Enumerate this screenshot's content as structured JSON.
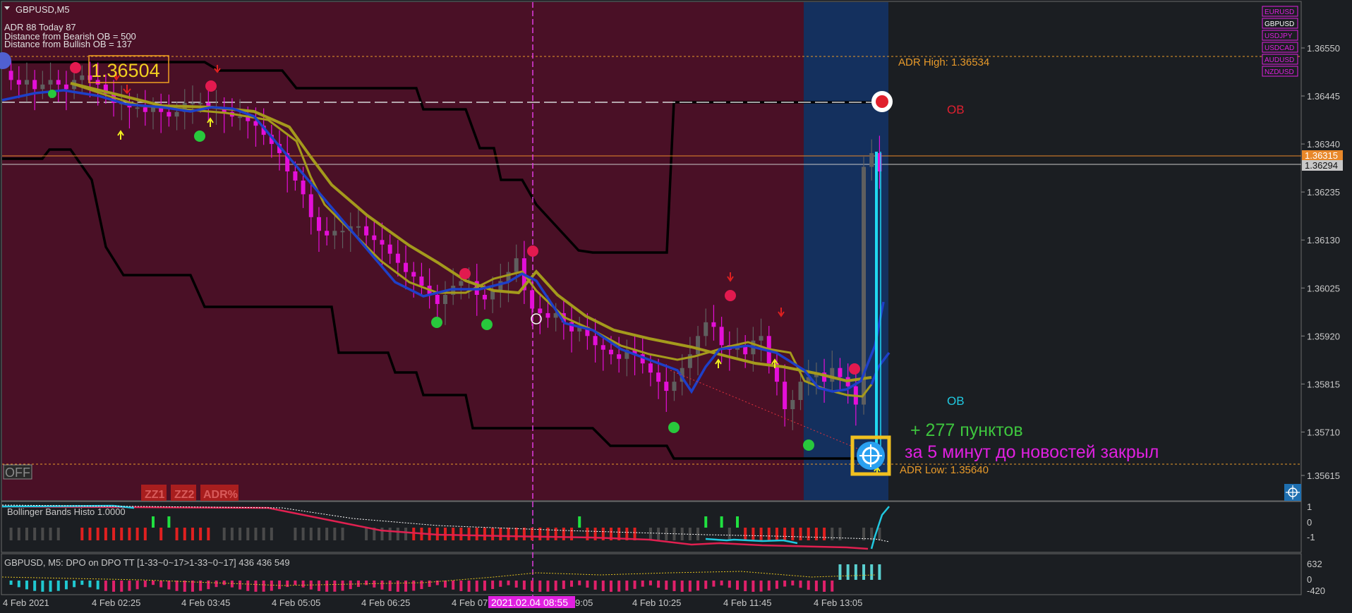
{
  "colors": {
    "bg": "#1b1e22",
    "zone_red": "#4a1026",
    "zone_blue": "#14305e",
    "axis_text": "#c8c8c8",
    "bear_candle": "#e40fd8",
    "bull_candle": "#5f5f5f",
    "ma_fast": "#1e40c8",
    "ma_slow": "#a49a1c",
    "envelope": "#000000",
    "adr_line": "#e89a2a",
    "ob_red": "#e02030",
    "ob_cyan": "#20c8e0",
    "profit_green": "#3ec63e",
    "note_magenta": "#e020e0",
    "dot_red": "#e21a4f",
    "dot_green": "#28c83c",
    "cursor_line": "#e03ce0",
    "price_tag_orange": "#e8882a",
    "price_tag_grey": "#c8c8c8"
  },
  "header": {
    "symbol": "GBPUSD,M5",
    "adr_line": "ADR 88  Today 87",
    "dist_bearish": "Distance from Bearish OB = 500",
    "dist_bullish": "Distance from Bullish OB = 137"
  },
  "price_callout": "1.36504",
  "symbols": [
    "EURUSD",
    "GBPUSD",
    "USDJPY",
    "USDCAD",
    "AUDUSD",
    "NZDUSD"
  ],
  "active_symbol_index": 1,
  "labels": {
    "adr_high": "ADR High: 1.36534",
    "adr_low": "ADR Low: 1.35640",
    "ob_top": "OB",
    "ob_bottom": "OB",
    "profit": "+ 277 пунктов",
    "note": "за 5 минут до новостей закрыл",
    "off_button": "OFF"
  },
  "tool_buttons": [
    "ZZ1",
    "ZZ2",
    "ADR%"
  ],
  "price_axis": {
    "ticks": [
      "1.36550",
      "1.36445",
      "1.36340",
      "1.36235",
      "1.36130",
      "1.36025",
      "1.35920",
      "1.35815",
      "1.35710",
      "1.35615"
    ],
    "tag_orange": "1.36315",
    "tag_grey": "1.36294"
  },
  "time_axis": {
    "ticks": [
      "4 Feb 2021",
      "4 Feb 02:25",
      "4 Feb 03:45",
      "4 Feb 05:05",
      "4 Feb 06:25",
      "4 Feb 07",
      "9:05",
      "4 Feb 10:25",
      "4 Feb 11:45",
      "4 Feb 13:05"
    ],
    "cursor_label": "2021.02.04 08:55"
  },
  "sub1": {
    "title": "Bollinger Bands Histo 1.0000",
    "ticks": [
      "1",
      "0",
      "-1"
    ]
  },
  "sub2": {
    "title": "GBPUSD, M5: DPO on DPO TT [1-33~0~17>1-33~0~17]  436 436 549",
    "ticks": [
      "632",
      "0",
      "-420"
    ]
  },
  "chart_data": {
    "type": "candlestick",
    "symbol": "GBPUSD",
    "timeframe": "M5",
    "ylim": [
      1.3559,
      1.3657
    ],
    "price_close": [
      1.3648,
      1.3647,
      1.3648,
      1.3646,
      1.3647,
      1.3648,
      1.3647,
      1.3646,
      1.3648,
      1.3649,
      1.3648,
      1.3647,
      1.3645,
      1.3643,
      1.3643,
      1.3642,
      1.3642,
      1.3641,
      1.3642,
      1.3641,
      1.364,
      1.3641,
      1.3643,
      1.3643,
      1.3643,
      1.3642,
      1.3642,
      1.3641,
      1.364,
      1.364,
      1.3639,
      1.3638,
      1.3636,
      1.3634,
      1.3632,
      1.3628,
      1.3626,
      1.3623,
      1.3618,
      1.3615,
      1.3614,
      1.3615,
      1.3615,
      1.3616,
      1.3616,
      1.3614,
      1.3613,
      1.3612,
      1.361,
      1.3608,
      1.3606,
      1.3605,
      1.3603,
      1.3601,
      1.3599,
      1.3601,
      1.3603,
      1.3604,
      1.3604,
      1.3601,
      1.36,
      1.3602,
      1.3604,
      1.3606,
      1.3609,
      1.3602,
      1.3598,
      1.3597,
      1.3596,
      1.3597,
      1.3595,
      1.3593,
      1.3594,
      1.3592,
      1.359,
      1.3589,
      1.3588,
      1.3587,
      1.3589,
      1.3588,
      1.3586,
      1.3584,
      1.3582,
      1.358,
      1.3582,
      1.3585,
      1.3588,
      1.3592,
      1.3595,
      1.3594,
      1.359,
      1.3589,
      1.359,
      1.3588,
      1.3591,
      1.3592,
      1.3586,
      1.3582,
      1.3576,
      1.3578,
      1.3582,
      1.3583,
      1.3584,
      1.3582,
      1.3585,
      1.3583,
      1.3581,
      1.3577,
      1.3629,
      1.3632,
      1.3628
    ]
  }
}
